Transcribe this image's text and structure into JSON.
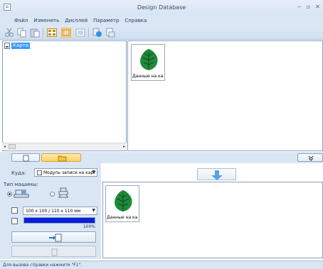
{
  "window": {
    "title": "Design Database"
  },
  "menu": [
    "Файл",
    "Изменить",
    "Дисплей",
    "Параметр",
    "Справка"
  ],
  "toolbar": {
    "icons": [
      "cut-icon",
      "copy-icon",
      "paste-icon",
      "large-icons-view-icon",
      "medium-icons-view-icon",
      "list-view-icon",
      "convert-icon",
      "export-icon"
    ]
  },
  "tree": {
    "root_label": "Карта"
  },
  "preview": {
    "items": [
      {
        "caption": "Данные на ка..."
      }
    ]
  },
  "transfer": {
    "where_label": "Куда:",
    "where_value": "Модуль записи на карт",
    "machine_type_label": "Тип машины:",
    "hoop_value": "100 x 100 / 110 x 110 мм",
    "progress_percent": 100,
    "progress_text": "100%",
    "machine_items": [
      {
        "caption": "Данные на ка..."
      }
    ]
  },
  "status": {
    "text": "Для вызова справки нажмите \"F1\"."
  },
  "colors": {
    "accent": "#3399ff",
    "progress": "#0a1fd8",
    "leaf": "#1e8a3a"
  }
}
